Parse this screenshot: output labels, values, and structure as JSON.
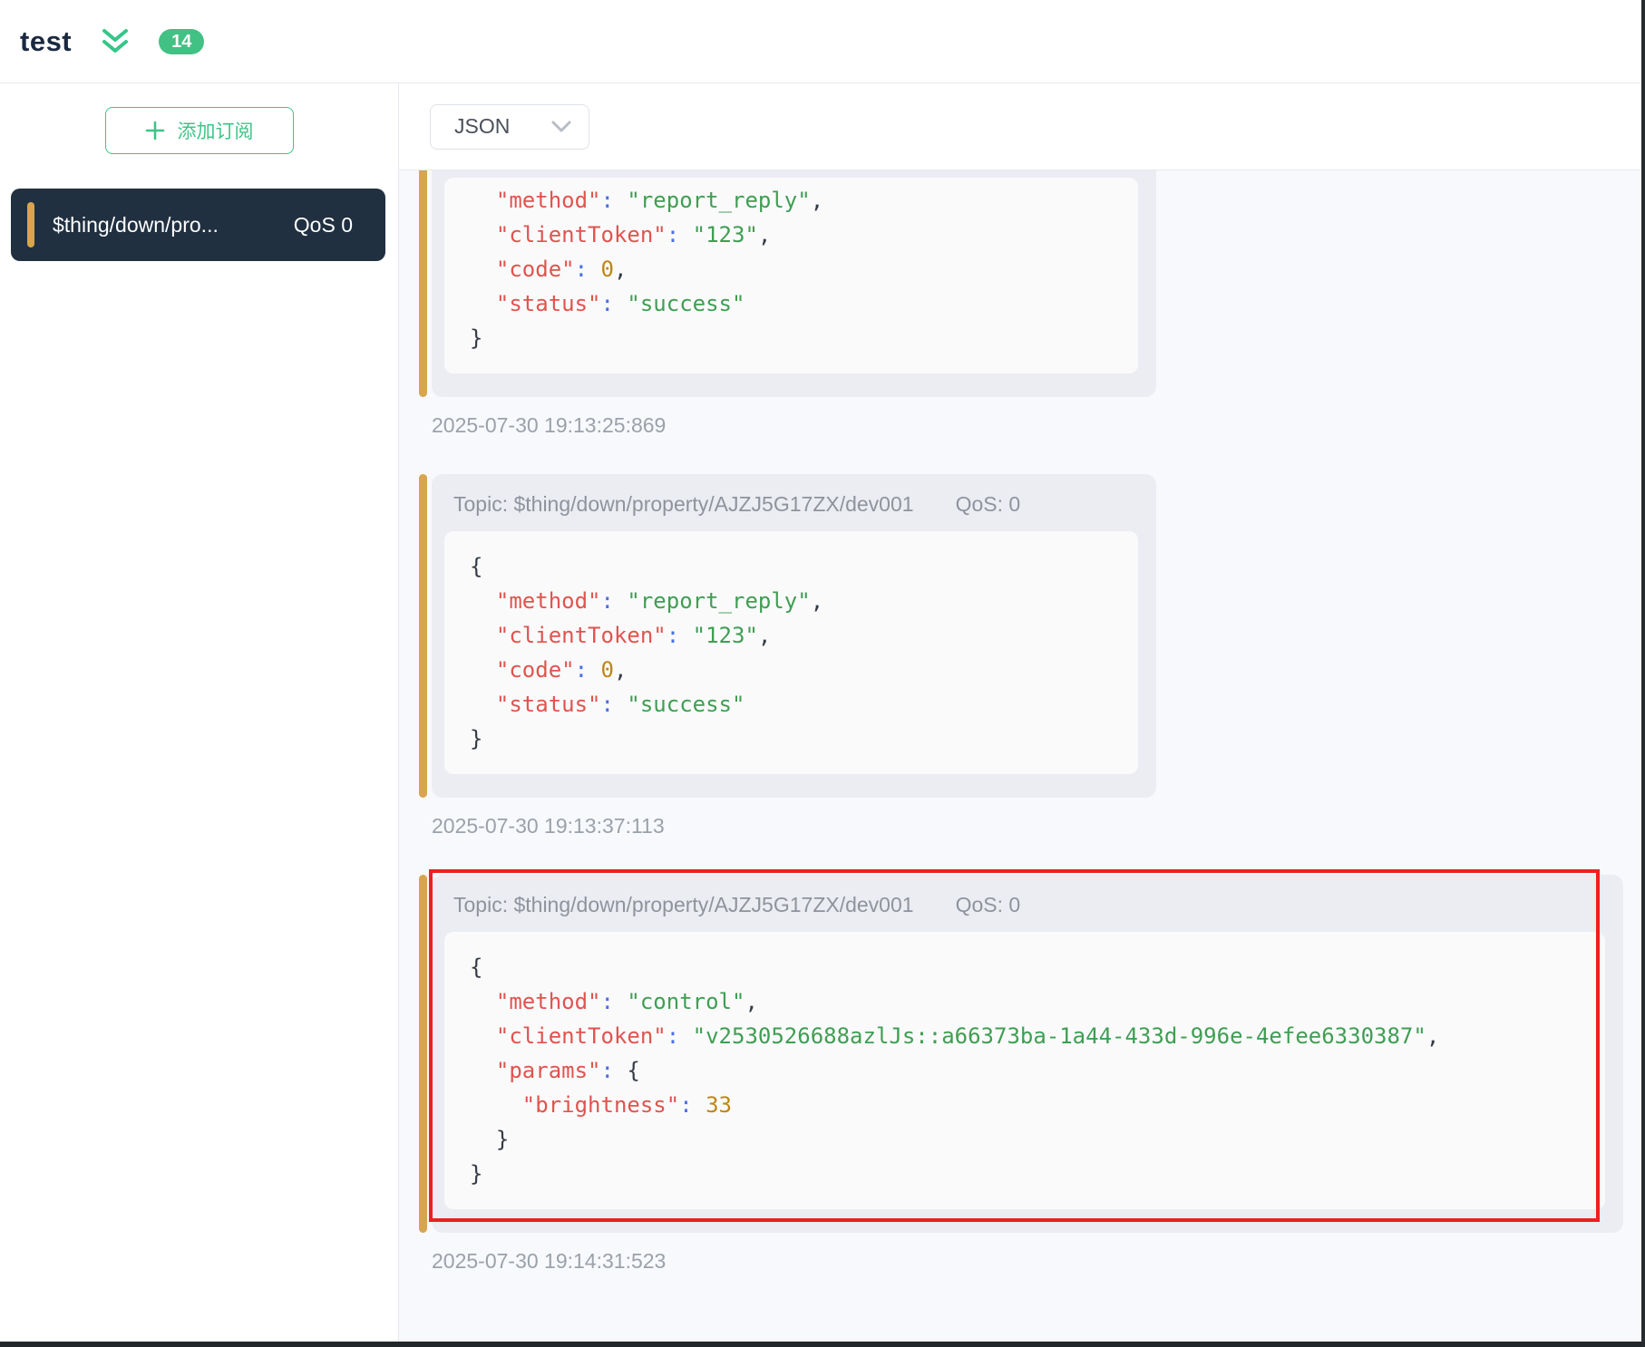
{
  "header": {
    "connection_name": "test",
    "message_count": "14"
  },
  "sidebar": {
    "add_subscription_label": "添加订阅",
    "subscription": {
      "topic": "$thing/down/pro...",
      "qos": "QoS 0"
    }
  },
  "toolbar": {
    "format_selected": "JSON"
  },
  "colors": {
    "accent_green": "#3fc487",
    "badge_green": "#41c184",
    "subscription_gold": "#d7a44f",
    "dark_navy_card": "#213040",
    "annotation_red": "#ee2020",
    "key_red": "#e0544e",
    "string_green": "#3f9e53",
    "number_gold": "#bf8615",
    "colon_blue": "#4a6fe8"
  },
  "feed": {
    "messages": [
      {
        "clipped": true,
        "wide": false,
        "highlighted": false,
        "timestamp": "2025-07-30 19:13:25:869",
        "payload_lines": [
          [
            {
              "t": "plain",
              "v": "  "
            },
            {
              "t": "key",
              "v": "\"method\""
            },
            {
              "t": "colon",
              "v": ": "
            },
            {
              "t": "str",
              "v": "\"report_reply\""
            },
            {
              "t": "punc",
              "v": ","
            }
          ],
          [
            {
              "t": "plain",
              "v": "  "
            },
            {
              "t": "key",
              "v": "\"clientToken\""
            },
            {
              "t": "colon",
              "v": ": "
            },
            {
              "t": "str",
              "v": "\"123\""
            },
            {
              "t": "punc",
              "v": ","
            }
          ],
          [
            {
              "t": "plain",
              "v": "  "
            },
            {
              "t": "key",
              "v": "\"code\""
            },
            {
              "t": "colon",
              "v": ": "
            },
            {
              "t": "num",
              "v": "0"
            },
            {
              "t": "punc",
              "v": ","
            }
          ],
          [
            {
              "t": "plain",
              "v": "  "
            },
            {
              "t": "key",
              "v": "\"status\""
            },
            {
              "t": "colon",
              "v": ": "
            },
            {
              "t": "str",
              "v": "\"success\""
            }
          ],
          [
            {
              "t": "punc",
              "v": "}"
            }
          ]
        ]
      },
      {
        "clipped": false,
        "wide": false,
        "highlighted": false,
        "topic": "Topic: $thing/down/property/AJZJ5G17ZX/dev001",
        "qos": "QoS: 0",
        "timestamp": "2025-07-30 19:13:37:113",
        "payload_lines": [
          [
            {
              "t": "punc",
              "v": "{"
            }
          ],
          [
            {
              "t": "plain",
              "v": "  "
            },
            {
              "t": "key",
              "v": "\"method\""
            },
            {
              "t": "colon",
              "v": ": "
            },
            {
              "t": "str",
              "v": "\"report_reply\""
            },
            {
              "t": "punc",
              "v": ","
            }
          ],
          [
            {
              "t": "plain",
              "v": "  "
            },
            {
              "t": "key",
              "v": "\"clientToken\""
            },
            {
              "t": "colon",
              "v": ": "
            },
            {
              "t": "str",
              "v": "\"123\""
            },
            {
              "t": "punc",
              "v": ","
            }
          ],
          [
            {
              "t": "plain",
              "v": "  "
            },
            {
              "t": "key",
              "v": "\"code\""
            },
            {
              "t": "colon",
              "v": ": "
            },
            {
              "t": "num",
              "v": "0"
            },
            {
              "t": "punc",
              "v": ","
            }
          ],
          [
            {
              "t": "plain",
              "v": "  "
            },
            {
              "t": "key",
              "v": "\"status\""
            },
            {
              "t": "colon",
              "v": ": "
            },
            {
              "t": "str",
              "v": "\"success\""
            }
          ],
          [
            {
              "t": "punc",
              "v": "}"
            }
          ]
        ]
      },
      {
        "clipped": false,
        "wide": true,
        "highlighted": true,
        "topic": "Topic: $thing/down/property/AJZJ5G17ZX/dev001",
        "qos": "QoS: 0",
        "timestamp": "2025-07-30 19:14:31:523",
        "payload_lines": [
          [
            {
              "t": "punc",
              "v": "{"
            }
          ],
          [
            {
              "t": "plain",
              "v": "  "
            },
            {
              "t": "key",
              "v": "\"method\""
            },
            {
              "t": "colon",
              "v": ": "
            },
            {
              "t": "str",
              "v": "\"control\""
            },
            {
              "t": "punc",
              "v": ","
            }
          ],
          [
            {
              "t": "plain",
              "v": "  "
            },
            {
              "t": "key",
              "v": "\"clientToken\""
            },
            {
              "t": "colon",
              "v": ": "
            },
            {
              "t": "str",
              "v": "\"v2530526688azlJs::a66373ba-1a44-433d-996e-4efee6330387\""
            },
            {
              "t": "punc",
              "v": ","
            }
          ],
          [
            {
              "t": "plain",
              "v": "  "
            },
            {
              "t": "key",
              "v": "\"params\""
            },
            {
              "t": "colon",
              "v": ": "
            },
            {
              "t": "punc",
              "v": "{"
            }
          ],
          [
            {
              "t": "plain",
              "v": "    "
            },
            {
              "t": "key",
              "v": "\"brightness\""
            },
            {
              "t": "colon",
              "v": ": "
            },
            {
              "t": "num",
              "v": "33"
            }
          ],
          [
            {
              "t": "plain",
              "v": "  "
            },
            {
              "t": "punc",
              "v": "}"
            }
          ],
          [
            {
              "t": "punc",
              "v": "}"
            }
          ]
        ]
      }
    ]
  }
}
